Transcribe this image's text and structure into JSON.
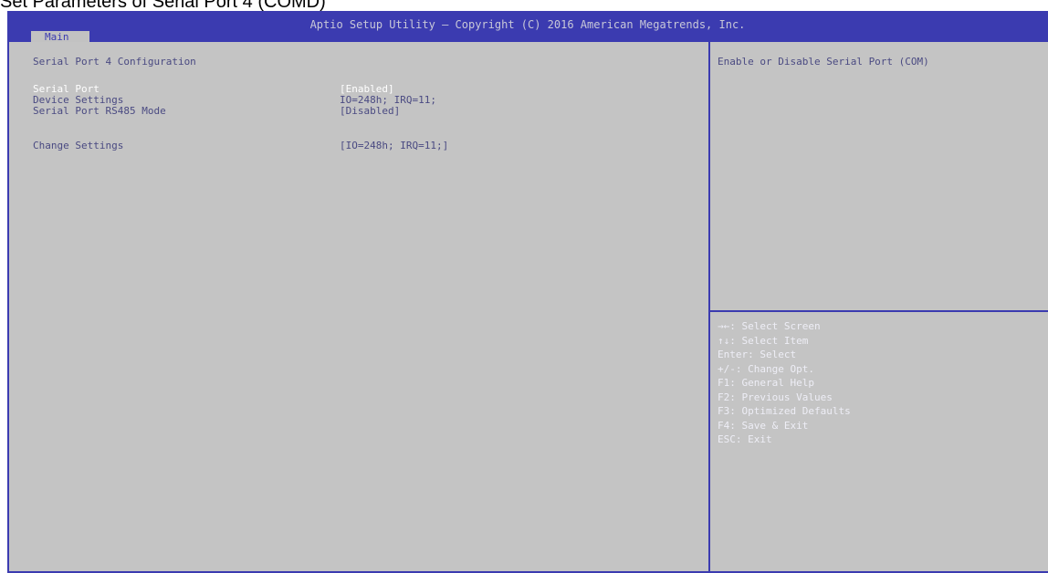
{
  "caption": "Set Parameters of Serial Port 4 (COMD)",
  "header": {
    "title": "Aptio Setup Utility – Copyright (C) 2016 American Megatrends, Inc.",
    "tab": "Main"
  },
  "page": {
    "heading": "Serial Port 4 Configuration",
    "items": [
      {
        "label": "Serial Port",
        "value": "[Enabled]",
        "selected": true
      },
      {
        "label": "Device Settings",
        "value": "IO=248h; IRQ=11;"
      },
      {
        "label": "Serial Port RS485 Mode",
        "value": "[Disabled]"
      },
      {
        "label": "Change Settings",
        "value": "[IO=248h; IRQ=11;]"
      }
    ]
  },
  "help": {
    "text": "Enable or Disable Serial Port (COM)"
  },
  "keys": [
    "→←: Select Screen",
    "↑↓: Select Item",
    "Enter: Select",
    "+/-: Change Opt.",
    "F1: General Help",
    "F2: Previous Values",
    "F3: Optimized Defaults",
    "F4: Save & Exit",
    "ESC: Exit"
  ],
  "colors": {
    "frame": "#3b3bb0",
    "panel": "#c4c4c4",
    "text": "#4a4a82",
    "selected": "#ffffff"
  }
}
